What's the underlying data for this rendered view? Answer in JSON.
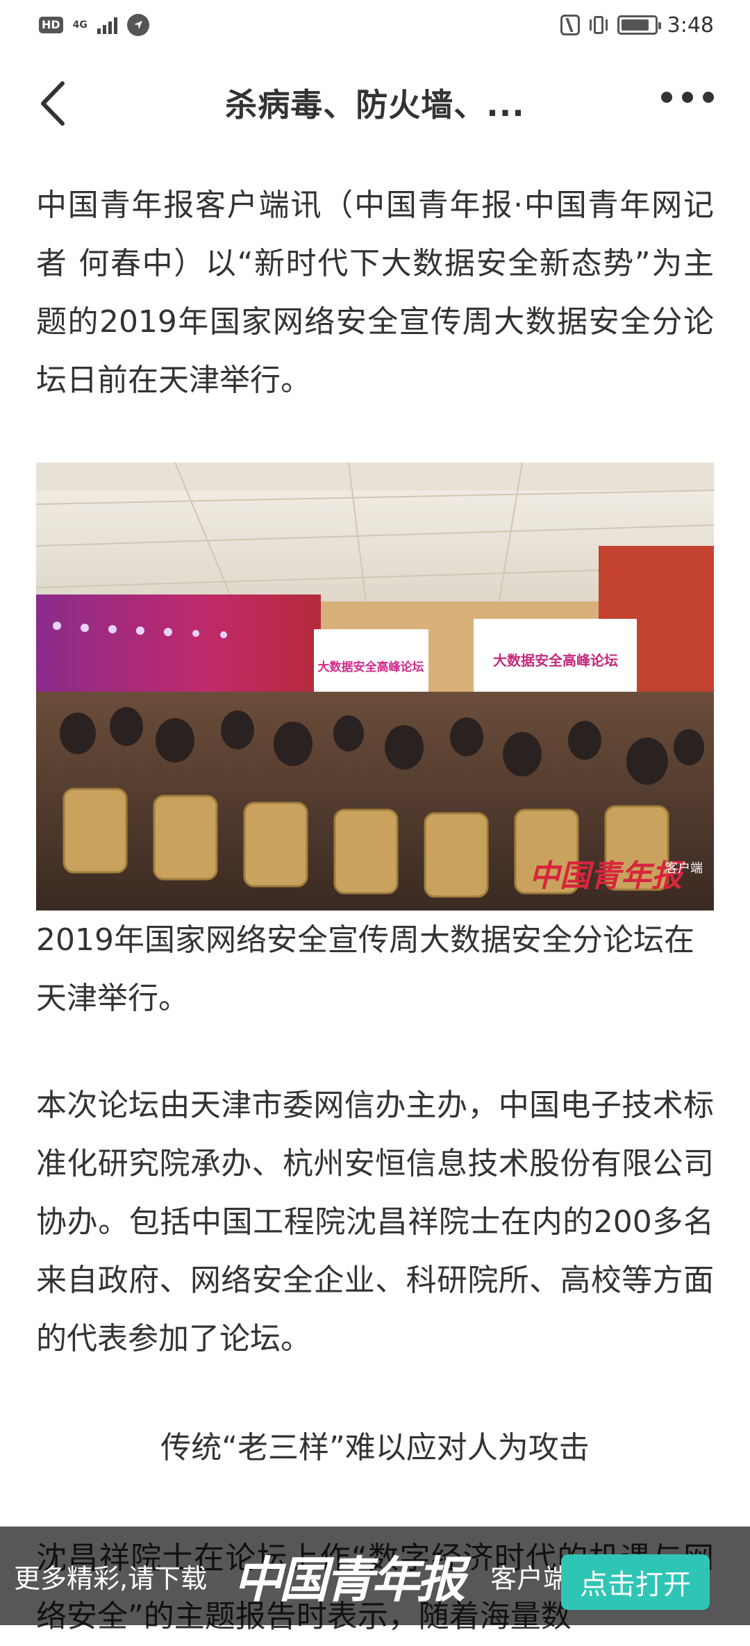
{
  "status_bar": {
    "hd": "HD",
    "network": "4G",
    "time": "3:48"
  },
  "nav": {
    "title": "杀病毒、防火墙、..."
  },
  "article": {
    "intro": "中国青年报客户端讯（中国青年报·中国青年网记者 何春中）以“新时代下大数据安全新态势”为主题的2019年国家网络安全宣传周大数据安全分论坛日前在天津举行。",
    "photo": {
      "screen_left_text": "大数据安全高峰论坛",
      "screen_right_text": "大数据安全高峰论坛",
      "watermark": "中国青年报",
      "watermark_tag": "客户端"
    },
    "caption": "2019年国家网络安全宣传周大数据安全分论坛在天津举行。",
    "body": "本次论坛由天津市委网信办主办，中国电子技术标准化研究院承办、杭州安恒信息技术股份有限公司协办。包括中国工程院沈昌祥院士在内的200多名来自政府、网络安全企业、科研院所、高校等方面的代表参加了论坛。",
    "subheading": "传统“老三样”难以应对人为攻击",
    "partial": "沈昌祥院士在论坛上作“数字经济时代的机遇与网络安全”的主题报告时表示，随着海量数"
  },
  "banner": {
    "text": "更多精彩,请下载",
    "logo": "中国青年报",
    "client": "客户端",
    "open_button": "点击打开"
  },
  "colors": {
    "accent": "#2fc5b5",
    "text": "#333333",
    "banner_bg": "rgba(0,0,0,0.66)"
  }
}
